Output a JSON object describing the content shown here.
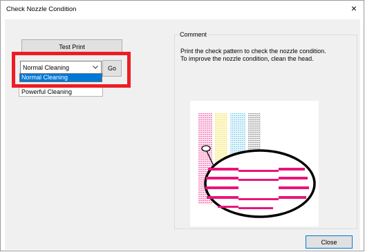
{
  "window": {
    "title": "Check Nozzle Condition",
    "close_glyph": "×"
  },
  "left_panel": {
    "test_print_label": "Test Print",
    "cleaning_select": {
      "selected": "Normal Cleaning",
      "options": [
        "Normal Cleaning",
        "Powerful Cleaning"
      ],
      "highlighted_option": "Normal Cleaning"
    },
    "go_label": "Go"
  },
  "comment": {
    "legend": "Comment",
    "lines": [
      "Print the check pattern to check the nozzle condition.",
      "To improve the nozzle condition, clean the head."
    ]
  },
  "footer": {
    "close_label": "Close"
  },
  "colors": {
    "highlight": "#ee1c24",
    "selection": "#0078d7",
    "magenta": "#e8157a",
    "yellow": "#f4ec85",
    "cyan": "#9fd8ec",
    "gray": "#9c9c9c"
  },
  "icons": [
    "close-icon",
    "chevron-down-icon"
  ]
}
